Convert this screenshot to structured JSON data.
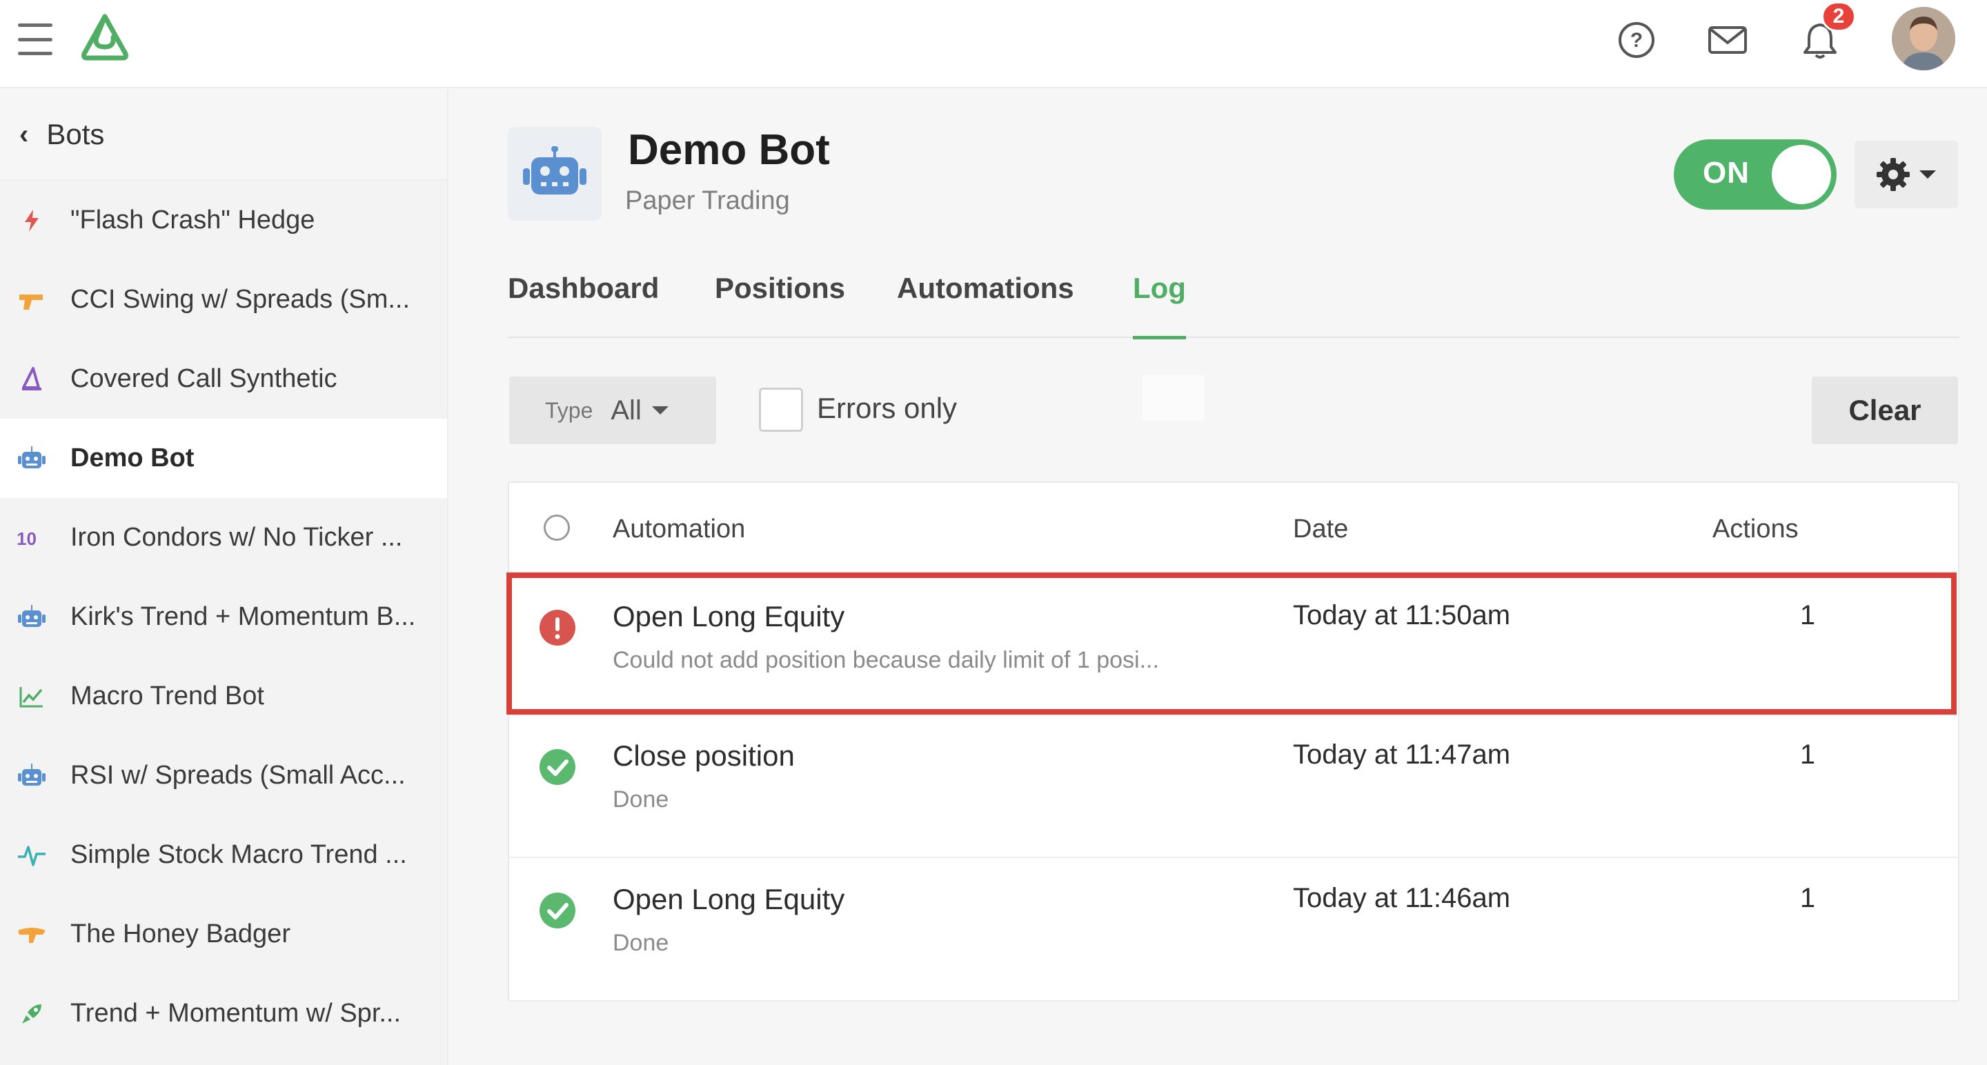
{
  "header": {
    "notification_count": "2",
    "accent_color": "#4fae64"
  },
  "sidebar": {
    "back_label": "Bots",
    "items": [
      {
        "label": "\"Flash Crash\" Hedge",
        "icon": "lightning-icon",
        "color": "#e0574f"
      },
      {
        "label": "CCI Swing w/ Spreads (Sm...",
        "icon": "pistol-icon",
        "color": "#f2a33a"
      },
      {
        "label": "Covered Call Synthetic",
        "icon": "wizard-hat-icon",
        "color": "#8a5bbf"
      },
      {
        "label": "Demo Bot",
        "icon": "robot-icon",
        "color": "#5a8fd0"
      },
      {
        "label": "Iron Condors w/ No Ticker ...",
        "icon": "ten-four-icon",
        "color": "#8a5bbf"
      },
      {
        "label": "Kirk's Trend + Momentum B...",
        "icon": "robot-icon",
        "color": "#5a8fd0"
      },
      {
        "label": "Macro Trend Bot",
        "icon": "chart-trend-icon",
        "color": "#4fae64"
      },
      {
        "label": "RSI w/ Spreads (Small Acc...",
        "icon": "robot-icon",
        "color": "#5a8fd0"
      },
      {
        "label": "Simple Stock Macro Trend ...",
        "icon": "pulse-icon",
        "color": "#3ab0b3"
      },
      {
        "label": "The Honey Badger",
        "icon": "badger-icon",
        "color": "#f2a33a"
      },
      {
        "label": "Trend + Momentum w/ Spr...",
        "icon": "rocket-icon",
        "color": "#4fae64"
      }
    ]
  },
  "bot": {
    "name": "Demo Bot",
    "subtitle": "Paper Trading",
    "toggle_label": "ON"
  },
  "tabs": [
    {
      "label": "Dashboard"
    },
    {
      "label": "Positions"
    },
    {
      "label": "Automations"
    },
    {
      "label": "Log",
      "active": true
    }
  ],
  "filters": {
    "type_label": "Type",
    "type_value": "All",
    "errors_only_label": "Errors only",
    "clear_label": "Clear"
  },
  "table": {
    "headers": {
      "automation": "Automation",
      "date": "Date",
      "actions": "Actions"
    },
    "rows": [
      {
        "status": "error",
        "name": "Open Long Equity",
        "desc": "Could not add position because daily limit of 1 posi...",
        "date": "Today at 11:50am",
        "actions": "1",
        "highlighted": true
      },
      {
        "status": "success",
        "name": "Close position",
        "desc": "Done",
        "date": "Today at 11:47am",
        "actions": "1"
      },
      {
        "status": "success",
        "name": "Open Long Equity",
        "desc": "Done",
        "date": "Today at 11:46am",
        "actions": "1"
      }
    ]
  }
}
